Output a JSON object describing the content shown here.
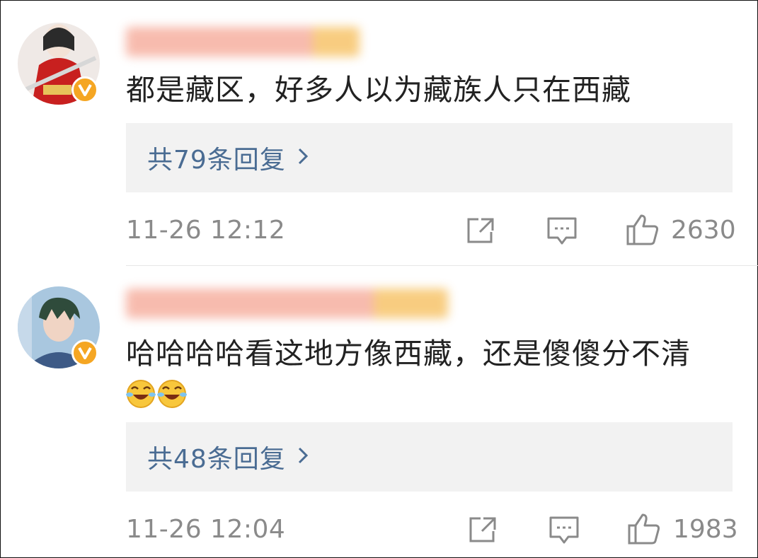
{
  "comments": [
    {
      "avatar_icon": "avatar-girl-red-dress",
      "verified_icon": "verified-v-badge-icon",
      "text": "都是藏区，好多人以为藏族人只在西藏",
      "reply_label": "共79条回复",
      "time": "11-26 12:12",
      "likes": "2630"
    },
    {
      "avatar_icon": "avatar-anime-boy",
      "verified_icon": "verified-v-badge-icon",
      "text": "哈哈哈哈看这地方像西藏，还是傻傻分不清",
      "emojis": [
        "laugh-cry-emoji",
        "laugh-cry-emoji"
      ],
      "reply_label": "共48条回复",
      "time": "11-26 12:04",
      "likes": "1983"
    }
  ],
  "colors": {
    "reply_link": "#4a6c93",
    "meta_gray": "#8a8a8a",
    "reply_bg": "#f2f2f2",
    "verified_badge": "#f5a623"
  }
}
